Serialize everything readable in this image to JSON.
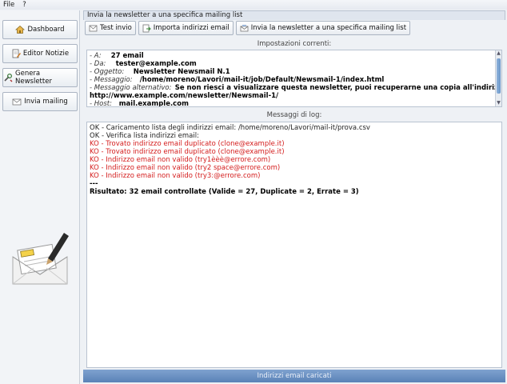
{
  "menu": {
    "file": "File",
    "help": "?"
  },
  "sidebar": {
    "items": [
      {
        "label": "Dashboard",
        "icon": "home-icon"
      },
      {
        "label": "Editor Notizie",
        "icon": "document-edit-icon"
      },
      {
        "label": "Genera Newsletter",
        "icon": "tools-icon"
      },
      {
        "label": "Invia mailing",
        "icon": "send-mail-icon"
      }
    ]
  },
  "main": {
    "title": "Invia la newsletter a una specifica mailing list",
    "toolbar": {
      "test_label": "Test invio",
      "import_label": "Importa indirizzi email",
      "send_label": "Invia la newsletter a una specifica mailing list"
    },
    "settings_label": "Impostazioni correnti:",
    "settings": {
      "a_key": "- A:",
      "a_val": "27 email",
      "da_key": "- Da:",
      "da_val": "tester@example.com",
      "oggetto_key": "- Oggetto:",
      "oggetto_val": "Newsletter Newsmail N.1",
      "messaggio_key": "- Messaggio:",
      "messaggio_val": "/home/moreno/Lavori/mail-it/job/Default/Newsmail-1/index.html",
      "alt_key": "- Messaggio alternativo:",
      "alt_val": "Se non riesci a visualizzare questa newsletter, puoi recuperarne una copia all'indirizzo'",
      "alt_url": "http://www.example.com/newsletter/Newsmail-1/",
      "host_key": "- Host:",
      "host_val": "mail.example.com"
    },
    "log_label": "Messaggi di log:",
    "log": {
      "line1": "OK - Caricamento lista degli indirizzi email: /home/moreno/Lavori/mail-it/prova.csv",
      "line2": "OK - Verifica lista indirizzi email:",
      "line3": "KO - Trovato indirizzo email duplicato (clone@example.it)",
      "line4": "KO - Trovato indirizzo email duplicato (clone@example.it)",
      "line5": "KO - Indirizzo email non valido (try1èèè@errore.com)",
      "line6": "KO - Indirizzo email non valido (try2 space@errore.com)",
      "line7": "KO - Indirizzo email non valido (try3:@errore.com)",
      "line8": "---",
      "result_label": "Risultato:",
      "result_val": "32 email controllate (Valide = 27, Duplicate = 2, Errate = 3)"
    },
    "status": "Indirizzi email caricati"
  }
}
